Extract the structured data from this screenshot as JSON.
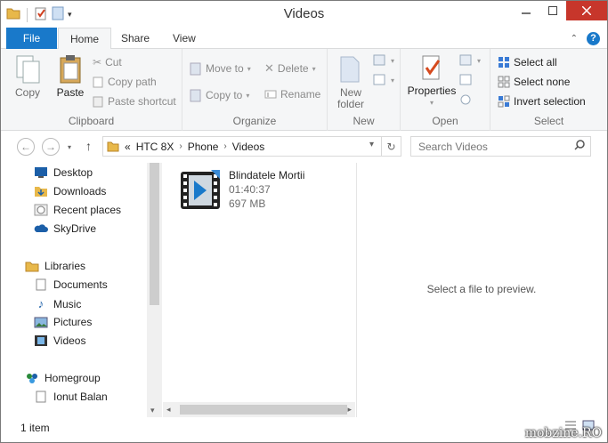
{
  "window": {
    "title": "Videos"
  },
  "tabs": [
    {
      "label": "File"
    },
    {
      "label": "Home"
    },
    {
      "label": "Share"
    },
    {
      "label": "View"
    }
  ],
  "ribbon": {
    "clipboard": {
      "label": "Clipboard",
      "copy": "Copy",
      "paste": "Paste",
      "cut": "Cut",
      "copy_path": "Copy path",
      "paste_shortcut": "Paste shortcut"
    },
    "organize": {
      "label": "Organize",
      "move_to": "Move to",
      "copy_to": "Copy to",
      "delete": "Delete",
      "rename": "Rename"
    },
    "new": {
      "label": "New",
      "new_folder_line1": "New",
      "new_folder_line2": "folder"
    },
    "open": {
      "label": "Open",
      "properties": "Properties"
    },
    "select": {
      "label": "Select",
      "select_all": "Select all",
      "select_none": "Select none",
      "invert_selection": "Invert selection"
    }
  },
  "address": {
    "overflow": "«",
    "crumbs": [
      "HTC 8X",
      "Phone",
      "Videos"
    ]
  },
  "search": {
    "placeholder": "Search Videos"
  },
  "nav": {
    "favorites": [
      "Desktop",
      "Downloads",
      "Recent places",
      "SkyDrive"
    ],
    "libraries_label": "Libraries",
    "libraries": [
      "Documents",
      "Music",
      "Pictures",
      "Videos"
    ],
    "homegroup_label": "Homegroup",
    "homegroup_user": "Ionut Balan"
  },
  "files": [
    {
      "name": "Blindatele Mortii",
      "duration": "01:40:37",
      "size": "697 MB"
    }
  ],
  "preview": {
    "message": "Select a file to preview."
  },
  "status": {
    "count": "1 item"
  },
  "watermark": "mobzine.RO",
  "colors": {
    "accent": "#1979ca",
    "close": "#c7362b",
    "folder": "#e8b84a"
  }
}
